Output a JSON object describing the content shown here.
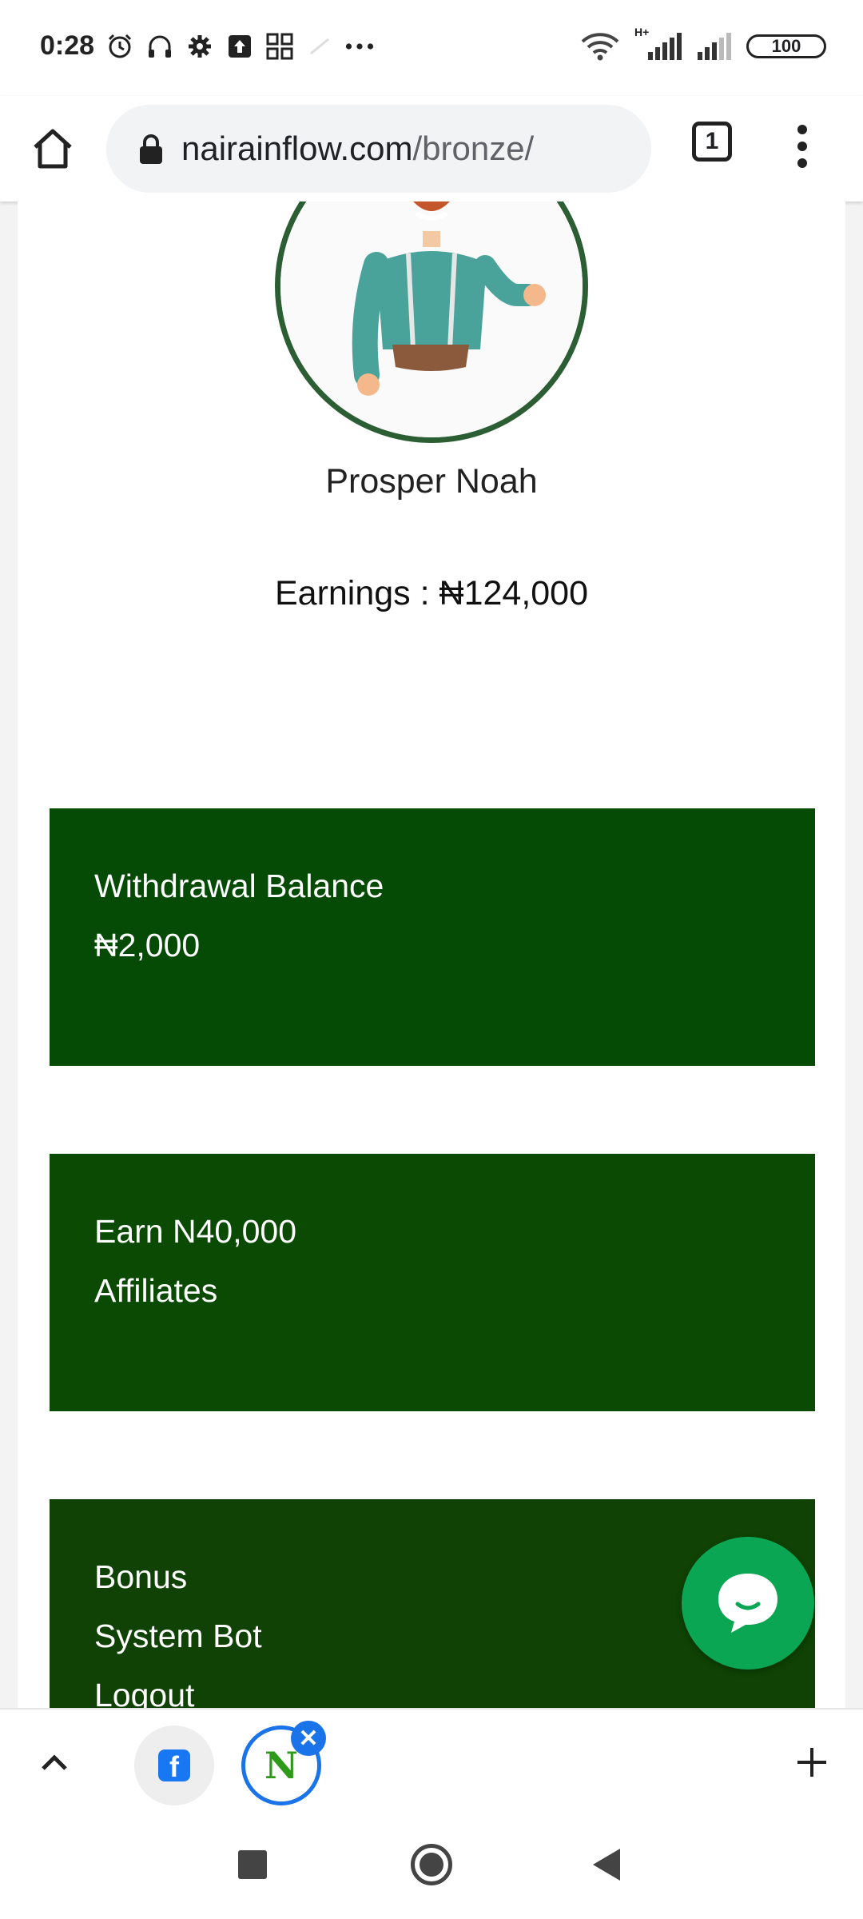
{
  "status_bar": {
    "time": "0:28",
    "battery": "100",
    "left_icons": [
      "alarm-icon",
      "headphones-icon",
      "gear-icon",
      "upload-icon",
      "app-grid-icon",
      "more-dots-icon"
    ],
    "right_icons": [
      "wifi-icon",
      "signal-icon",
      "signal-icon"
    ],
    "network_label": "H+"
  },
  "browser": {
    "url_domain": "nairainflow.com",
    "url_path": "/bronze/",
    "tab_count": "1"
  },
  "profile": {
    "name": "Prosper Noah",
    "earnings": "Earnings : ₦124,000"
  },
  "cards": [
    {
      "lines": [
        "Withdrawal Balance",
        "₦2,000"
      ],
      "color": "#054a05"
    },
    {
      "lines": [
        "Earn N40,000",
        "Affiliates"
      ],
      "color": "#0a4a03"
    },
    {
      "lines": [
        "Bonus",
        "System Bot",
        "Logout"
      ],
      "color": "#0f4204"
    }
  ],
  "chat_fab": {
    "icon": "chat-bubble-icon",
    "color": "#0aa653"
  },
  "tab_strip": {
    "tabs": [
      {
        "icon": "facebook-icon",
        "letter": "f"
      },
      {
        "icon": "nairainflow-favicon-icon",
        "letter": "N"
      }
    ],
    "close_symbol": "✕"
  },
  "colors": {
    "accent": "#1a73e8",
    "avatar_border": "#2c5e34"
  }
}
